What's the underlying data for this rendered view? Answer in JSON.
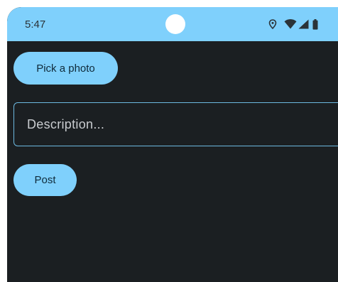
{
  "status_bar": {
    "time": "5:47",
    "icons": [
      "location-icon",
      "wifi-icon",
      "signal-icon",
      "battery-icon"
    ]
  },
  "actions": {
    "pick_photo_label": "Pick a photo",
    "post_label": "Post"
  },
  "description": {
    "placeholder": "Description...",
    "value": ""
  },
  "colors": {
    "accent": "#7fd0fc",
    "background": "#1b1f22",
    "field_border": "#6cb9e0"
  }
}
